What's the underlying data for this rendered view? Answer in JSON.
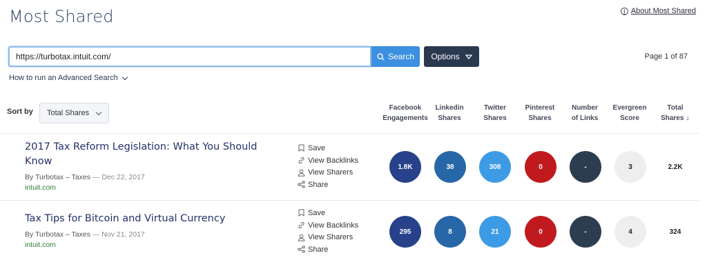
{
  "header": {
    "title": "Most Shared",
    "about_label": "About Most Shared"
  },
  "search": {
    "value": "https://turbotax.intuit.com/",
    "button_label": "Search",
    "options_label": "Options"
  },
  "pagination": {
    "text": "Page 1 of 87"
  },
  "advanced_search_label": "How to run an Advanced Search",
  "sort": {
    "label": "Sort by",
    "value": "Total Shares"
  },
  "columns": [
    [
      "Facebook",
      "Engagements"
    ],
    [
      "Linkedin",
      "Shares"
    ],
    [
      "Twitter",
      "Shares"
    ],
    [
      "Pinterest",
      "Shares"
    ],
    [
      "Number",
      "of Links"
    ],
    [
      "Evergreen",
      "Score"
    ],
    [
      "Total",
      "Shares"
    ]
  ],
  "actions": [
    "Save",
    "View Backlinks",
    "View Sharers",
    "Share"
  ],
  "results": [
    {
      "title": "2017 Tax Reform Legislation: What You Should Know",
      "author": "By Turbotax – Taxes",
      "date": "Dec 22, 2017",
      "domain": "intuit.com",
      "metrics": {
        "facebook": "1.8K",
        "linkedin": "38",
        "twitter": "308",
        "pinterest": "0",
        "links": "-",
        "evergreen": "3",
        "total": "2.2K"
      }
    },
    {
      "title": "Tax Tips for Bitcoin and Virtual Currency",
      "author": "By Turbotax – Taxes",
      "date": "Nov 21, 2017",
      "domain": "intuit.com",
      "metrics": {
        "facebook": "295",
        "linkedin": "8",
        "twitter": "21",
        "pinterest": "0",
        "links": "-",
        "evergreen": "4",
        "total": "324"
      }
    }
  ],
  "colors": {
    "facebook": "#27428a",
    "linkedin": "#2767a8",
    "twitter": "#3d9be6",
    "pinterest": "#c01a1f",
    "links": "#2d3d50",
    "evergreen": "#eeeeee",
    "title": "#2c3e63",
    "domain": "#2e7d32"
  },
  "icons": {
    "about": "info-circle-icon",
    "search": "search-icon",
    "options": "caret-down-icon",
    "advanced": "chevron-down-icon",
    "sort": "chevron-down-icon",
    "total_sort": "arrow-down-icon",
    "save": "bookmark-icon",
    "backlinks": "link-icon",
    "sharers": "user-icon",
    "share": "share-icon"
  }
}
